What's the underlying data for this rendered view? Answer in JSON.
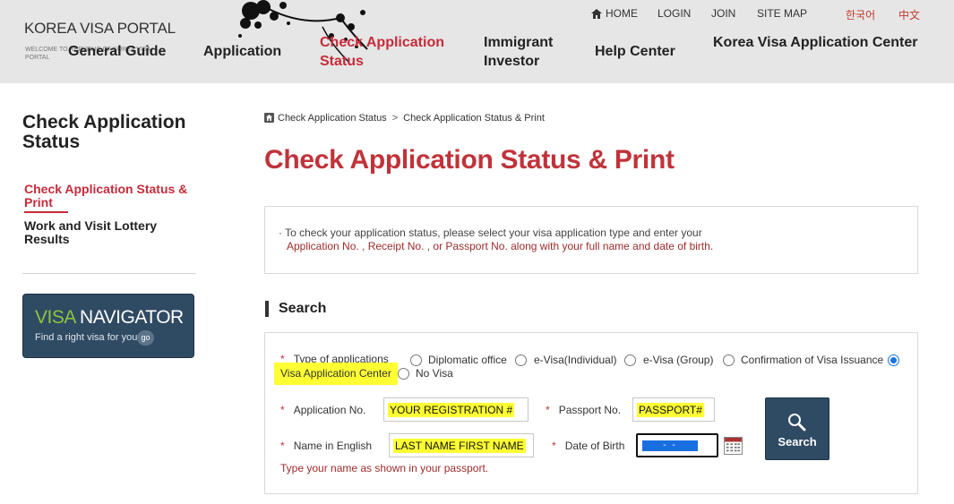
{
  "header": {
    "logo_title": "KOREA VISA PORTAL",
    "logo_sub": "WELCOME TO REPUBLIC OF KOREA VISA PORTAL",
    "util": {
      "home": "HOME",
      "login": "LOGIN",
      "join": "JOIN",
      "sitemap": "SITE MAP",
      "lang_ko": "한국어",
      "lang_zh": "中文"
    },
    "gnb": [
      {
        "label": "General Guide"
      },
      {
        "label": "Application"
      },
      {
        "label": "Check Application Status"
      },
      {
        "label": "Immigrant Investor"
      },
      {
        "label": "Help Center"
      },
      {
        "label": "Korea Visa Application Center"
      }
    ]
  },
  "sidebar": {
    "title": "Check Application Status",
    "items": [
      {
        "label": "Check Application Status & Print"
      },
      {
        "label": "Work and Visit Lottery Results"
      }
    ],
    "banner": {
      "title_a": "VISA",
      "title_b": " NAVIGATOR",
      "sub": "Find a right visa for you",
      "go": "go"
    }
  },
  "breadcrumb": {
    "items": [
      "Check Application Status",
      "Check Application Status & Print"
    ],
    "separator": ">"
  },
  "page_title": "Check Application Status & Print",
  "info": {
    "line1": "· To check your application status, please select your visa application type and enter your",
    "line2": "Application No. , Receipt No. , or Passport No. along with your full name and date of birth."
  },
  "search": {
    "section_title": "Search",
    "required_mark": "*",
    "type_label": "Type of applications",
    "types": [
      {
        "label": "Diplomatic office"
      },
      {
        "label": "e-Visa(Individual)"
      },
      {
        "label": "e-Visa (Group)"
      },
      {
        "label": "Confirmation of Visa Issuance"
      },
      {
        "label": "Visa Application Center"
      },
      {
        "label": "No Visa"
      }
    ],
    "application_no_label": "Application No.",
    "application_no_value": "YOUR REGISTRATION #",
    "passport_label": "Passport No.",
    "passport_value": "PASSPORT#",
    "name_label": "Name in English",
    "name_value": "LAST NAME FIRST NAME",
    "dob_label": "Date of Birth",
    "dob_value": "-  -",
    "button_label": "Search",
    "hint": "Type your name as shown in your passport."
  }
}
